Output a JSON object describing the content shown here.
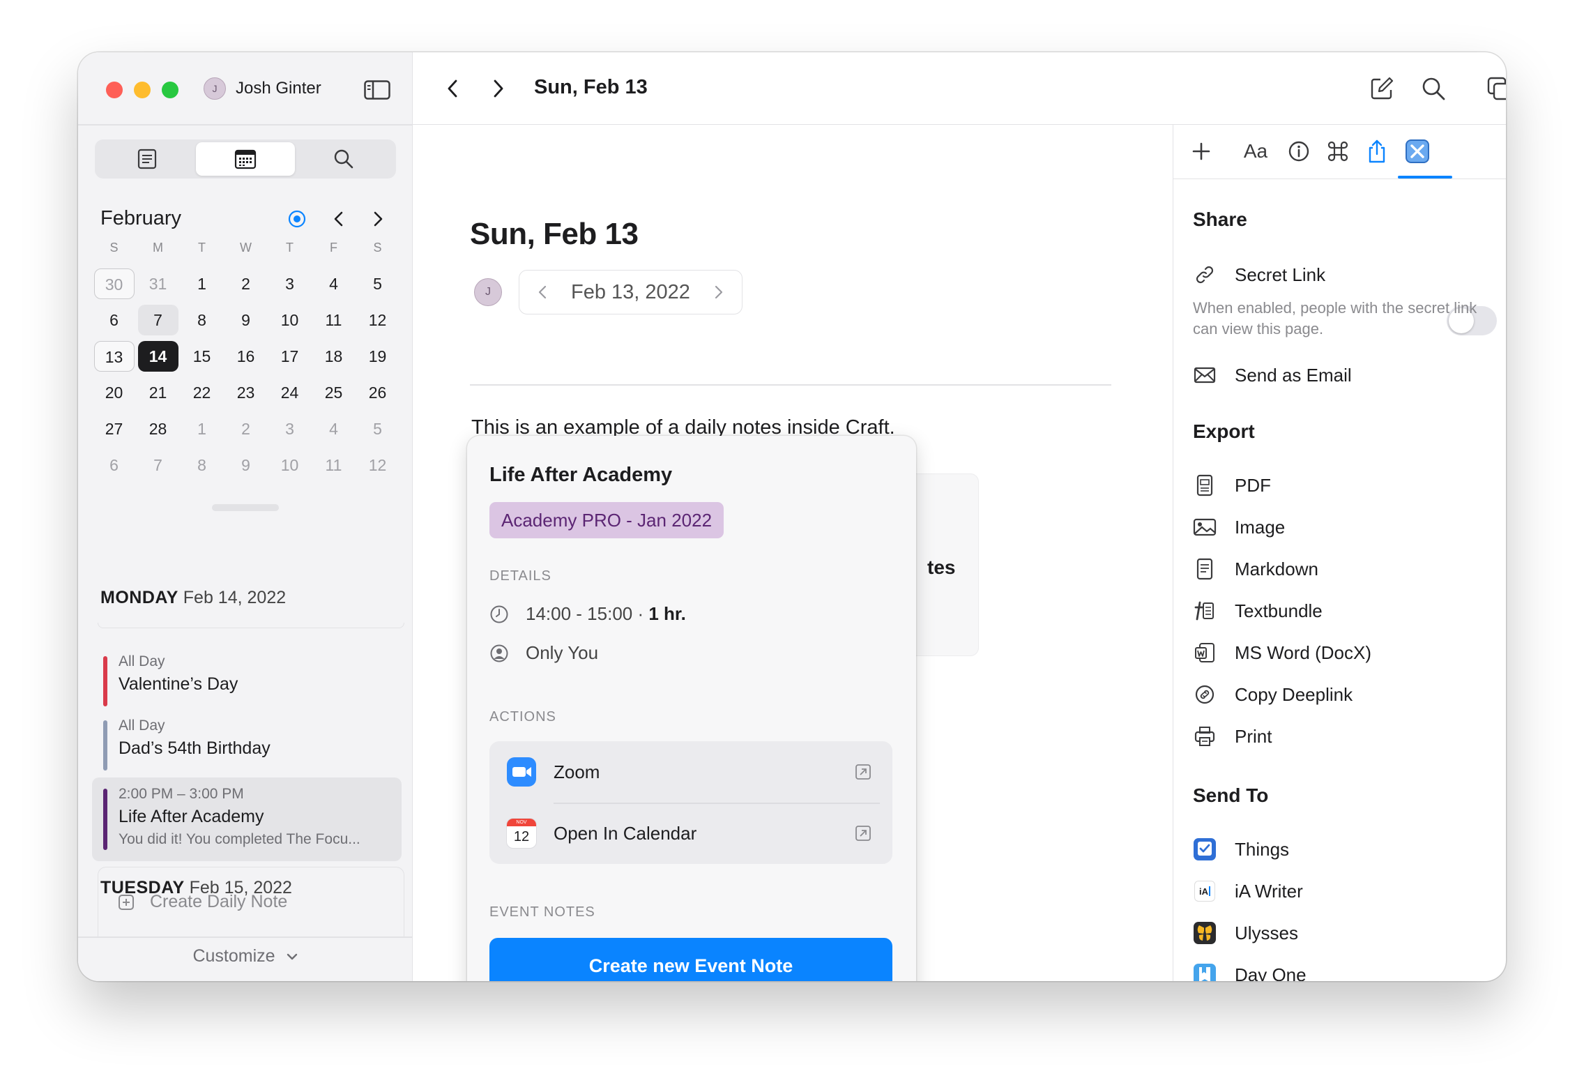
{
  "window": {
    "user_name": "Josh Ginter",
    "user_initial": "J"
  },
  "sidebar": {
    "calendar": {
      "month": "February",
      "weekdays": [
        "S",
        "M",
        "T",
        "W",
        "T",
        "F",
        "S"
      ],
      "weeks": [
        [
          "30",
          "31",
          "1",
          "2",
          "3",
          "4",
          "5"
        ],
        [
          "6",
          "7",
          "8",
          "9",
          "10",
          "11",
          "12"
        ],
        [
          "13",
          "14",
          "15",
          "16",
          "17",
          "18",
          "19"
        ],
        [
          "20",
          "21",
          "22",
          "23",
          "24",
          "25",
          "26"
        ],
        [
          "27",
          "28",
          "1",
          "2",
          "3",
          "4",
          "5"
        ],
        [
          "6",
          "7",
          "8",
          "9",
          "10",
          "11",
          "12"
        ]
      ]
    },
    "monday": {
      "weekday": "MONDAY",
      "date": "Feb 14, 2022"
    },
    "events": [
      {
        "sub": "All Day",
        "title": "Valentine’s Day",
        "color": "#d93a4a"
      },
      {
        "sub": "All Day",
        "title": "Dad’s 54th Birthday",
        "color": "#8f9bb3"
      },
      {
        "sub": "2:00 PM – 3:00 PM",
        "title": "Life After Academy",
        "note": "You did it! You completed The Focu...",
        "color": "#5b2573"
      }
    ],
    "tuesday": {
      "weekday": "TUESDAY",
      "date": "Feb 15, 2022"
    },
    "create_daily_note": "Create Daily Note",
    "customize": "Customize"
  },
  "toolbar": {
    "title": "Sun, Feb 13"
  },
  "document": {
    "title": "Sun, Feb 13",
    "date_pill": "Feb 13, 2022",
    "author_initial": "J",
    "body": "This is an example of a daily notes inside Craft.",
    "card_text": "tes"
  },
  "popover": {
    "title": "Life After Academy",
    "tag": "Academy PRO - Jan 2022",
    "details_label": "DETAILS",
    "time": "14:00 - 15:00 · ",
    "duration": "1 hr.",
    "attendees": "Only You",
    "actions_label": "ACTIONS",
    "actions": [
      {
        "label": "Zoom"
      },
      {
        "label": "Open In Calendar",
        "icon_month": "NOV",
        "icon_day": "12"
      }
    ],
    "notes_label": "EVENT NOTES",
    "create_button": "Create new Event Note"
  },
  "right_panel": {
    "share": {
      "heading": "Share",
      "secret_link": "Secret Link",
      "secret_desc": "When enabled, people with the secret link can view this page.",
      "send_email": "Send as Email"
    },
    "export": {
      "heading": "Export",
      "items": [
        "PDF",
        "Image",
        "Markdown",
        "Textbundle",
        "MS Word (DocX)",
        "Copy Deeplink",
        "Print"
      ]
    },
    "send_to": {
      "heading": "Send To",
      "items": [
        "Things",
        "iA Writer",
        "Ulysses",
        "Day One"
      ]
    },
    "tab_labels": {
      "font": "Aa"
    },
    "icon_labels": {
      "ia_writer": "iA"
    }
  },
  "colors": {
    "accent": "#0a84ff",
    "tag_bg": "#dbc5e3",
    "tag_text": "#5b2573"
  }
}
